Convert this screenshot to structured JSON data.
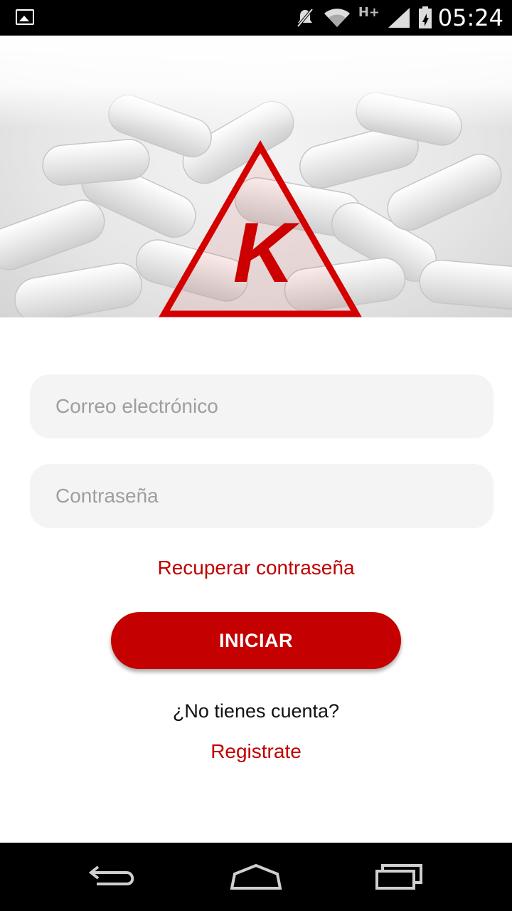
{
  "status_bar": {
    "network": "H+",
    "time": "05:24",
    "icons": [
      "image-notification-icon",
      "muted-icon",
      "wifi-icon",
      "signal-icon",
      "battery-icon"
    ]
  },
  "hero": {
    "logo_letter": "K",
    "logo_color": "#d40000"
  },
  "login": {
    "email_placeholder": "Correo electrónico",
    "password_placeholder": "Contraseña",
    "recover_label": "Recuperar contraseña",
    "submit_label": "INICIAR",
    "no_account_text": "¿No tienes cuenta?",
    "register_label": "Registrate"
  },
  "colors": {
    "accent": "#c40000",
    "field_bg": "#f4f4f4",
    "placeholder": "#9e9e9e"
  },
  "nav_bar": {
    "icons": [
      "back-icon",
      "home-icon",
      "recent-apps-icon"
    ]
  }
}
